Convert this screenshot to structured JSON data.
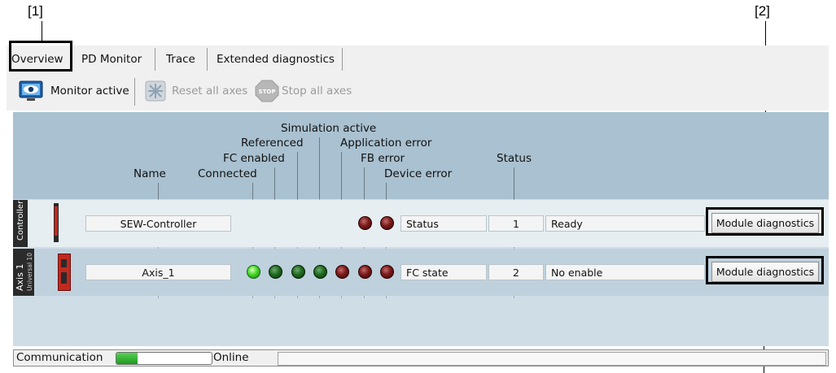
{
  "callouts": {
    "c1": "[1]",
    "c2": "[2]"
  },
  "tabs": [
    "Overview",
    "PD Monitor",
    "Trace",
    "Extended diagnostics"
  ],
  "toolbar": {
    "monitor_label": "Monitor active",
    "reset_label": "Reset all axes",
    "stop_label": "Stop all axes",
    "stop_icon_text": "STOP"
  },
  "headers": {
    "name": "Name",
    "connected": "Connected",
    "fc_enabled": "FC enabled",
    "referenced": "Referenced",
    "simulation_active": "Simulation active",
    "application_error": "Application error",
    "fb_error": "FB error",
    "device_error": "Device error",
    "status": "Status"
  },
  "rows": [
    {
      "tab_label": "Controller",
      "sub_label": "",
      "name": "SEW-Controller",
      "led_states": [
        "none",
        "none",
        "none",
        "none",
        "none",
        "red",
        "red"
      ],
      "state_label": "Status",
      "status_value": "1",
      "status_text": "Ready",
      "button": "Module diagnostics"
    },
    {
      "tab_label": "Axis 1",
      "sub_label": "Universal 10",
      "name": "Axis_1",
      "led_states": [
        "green",
        "dark-green",
        "dark-green",
        "dark-green",
        "red",
        "red",
        "red"
      ],
      "state_label": "FC state",
      "status_value": "2",
      "status_text": "No enable",
      "button": "Module diagnostics"
    }
  ],
  "statusbar": {
    "label": "Communication",
    "progress": 0.22,
    "state": "Online"
  },
  "colors": {
    "header_bg": "#a9c1d0",
    "row_bg": "#cfdde6",
    "led_red": "#7a1a1a",
    "led_green": "#42d626",
    "led_dark_green": "#1f6a1f"
  }
}
